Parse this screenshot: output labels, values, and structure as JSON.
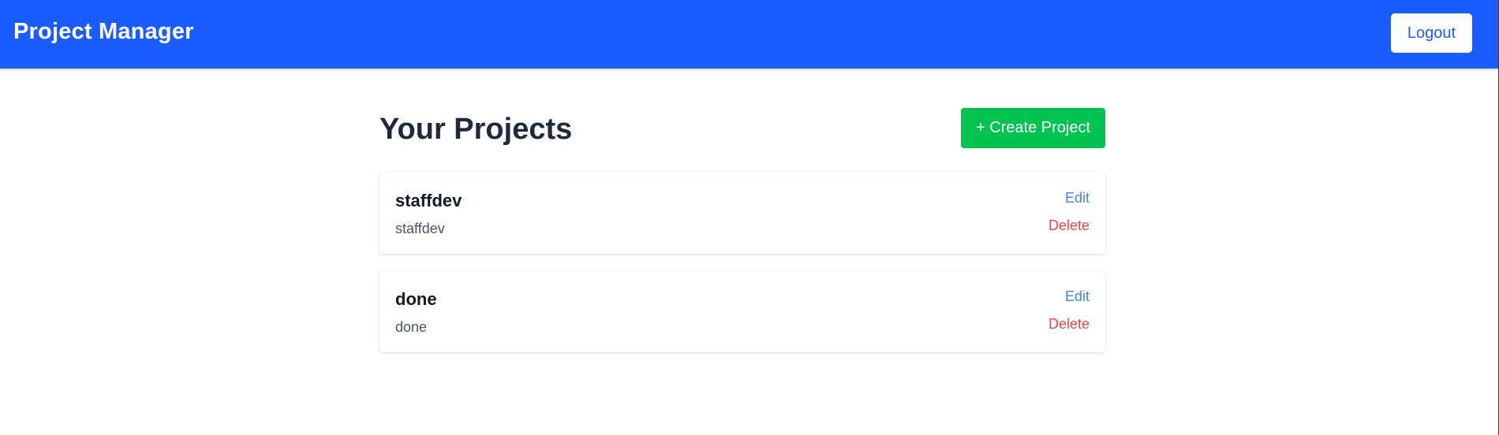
{
  "navbar": {
    "brand": "Project Manager",
    "logout_label": "Logout",
    "background_color": "#1a5dff"
  },
  "main": {
    "title": "Your Projects",
    "create_label": "+ Create Project",
    "create_color": "#00c44f"
  },
  "projects": [
    {
      "name": "staffdev",
      "description": "staffdev",
      "edit_label": "Edit",
      "delete_label": "Delete"
    },
    {
      "name": "done",
      "description": "done",
      "edit_label": "Edit",
      "delete_label": "Delete"
    }
  ],
  "colors": {
    "edit": "#3b82f6",
    "delete": "#ef4444"
  }
}
